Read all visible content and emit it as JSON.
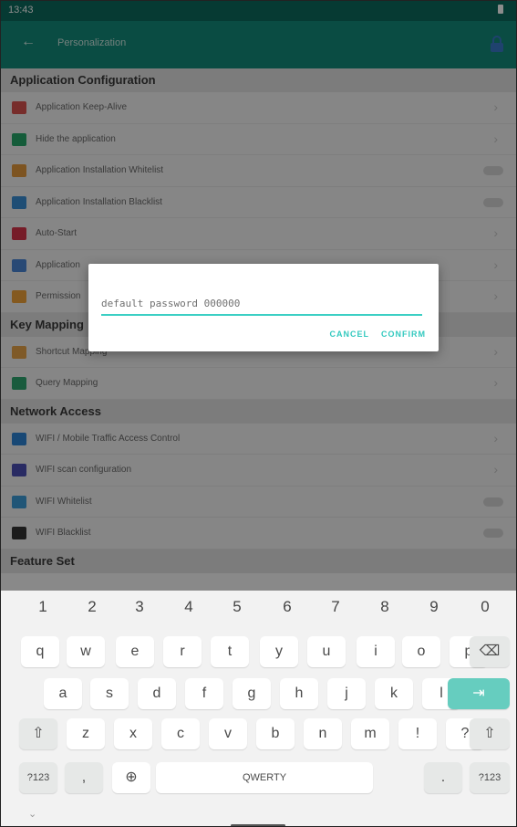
{
  "status": {
    "time": "13:43"
  },
  "appbar": {
    "back_glyph": "←",
    "title": "Personalization",
    "right_icon": "lock-icon"
  },
  "sections": [
    {
      "title": "Application Configuration",
      "items": [
        {
          "label": "Application Keep-Alive",
          "control": "chevron",
          "icon_color": "#d9534f"
        },
        {
          "label": "Hide the application",
          "control": "chevron",
          "icon_color": "#27a86a"
        },
        {
          "label": "Application Installation Whitelist",
          "control": "toggle",
          "icon_color": "#e39a3c"
        },
        {
          "label": "Application Installation Blacklist",
          "control": "toggle",
          "icon_color": "#3a8fd6"
        },
        {
          "label": "Auto-Start",
          "control": "chevron",
          "icon_color": "#d8334a"
        },
        {
          "label": "Application",
          "control": "chevron",
          "icon_color": "#4a86d6"
        },
        {
          "label": "Permission",
          "control": "chevron",
          "icon_color": "#f0a23a"
        }
      ]
    },
    {
      "title": "Key Mapping",
      "items": [
        {
          "label": "Shortcut Mapping",
          "control": "chevron",
          "icon_color": "#e7a44a"
        },
        {
          "label": "Query Mapping",
          "control": "chevron",
          "icon_color": "#2ea770"
        }
      ]
    },
    {
      "title": "Network Access",
      "items": [
        {
          "label": "WIFI / Mobile Traffic Access Control",
          "control": "chevron",
          "icon_color": "#2d83d6"
        },
        {
          "label": "WIFI scan configuration",
          "control": "chevron",
          "icon_color": "#4c4fb5"
        },
        {
          "label": "WIFI Whitelist",
          "control": "toggle",
          "icon_color": "#3c9dd9"
        },
        {
          "label": "WIFI Blacklist",
          "control": "toggle",
          "icon_color": "#333333"
        }
      ]
    },
    {
      "title": "Feature Set",
      "items": []
    }
  ],
  "dialog": {
    "placeholder": "default password 000000",
    "cancel": "CANCEL",
    "confirm": "CONFIRM"
  },
  "keyboard": {
    "numbers": [
      "1",
      "2",
      "3",
      "4",
      "5",
      "6",
      "7",
      "8",
      "9",
      "0"
    ],
    "row1": [
      "q",
      "w",
      "e",
      "r",
      "t",
      "y",
      "u",
      "i",
      "o",
      "p"
    ],
    "row2": [
      "a",
      "s",
      "d",
      "f",
      "g",
      "h",
      "j",
      "k",
      "l"
    ],
    "row3": [
      "z",
      "x",
      "c",
      "v",
      "b",
      "n",
      "m",
      "!",
      "?"
    ],
    "backspace": "⌫",
    "tab": "⇥",
    "shift": "⇧",
    "sym": "?123",
    "comma": ",",
    "globe": "⊕",
    "space": "QWERTY",
    "period": "."
  }
}
